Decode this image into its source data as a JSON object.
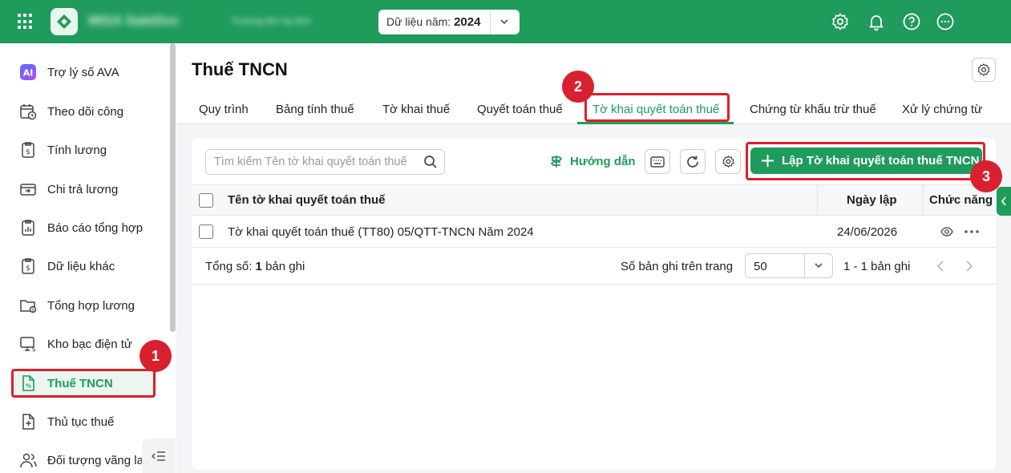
{
  "topbar": {
    "brand": "MISA SaleDoc",
    "company": "Trường Mn hạ tỉnh",
    "year_label": "Dữ liệu năm:",
    "year_value": "2024"
  },
  "sidebar": {
    "items": [
      {
        "label": "Trợ lý số AVA",
        "icon": "ai-icon"
      },
      {
        "label": "Theo dõi công",
        "icon": "calendar-clock-icon"
      },
      {
        "label": "Tính lương",
        "icon": "salary-doc-icon"
      },
      {
        "label": "Chi trả lương",
        "icon": "wallet-icon"
      },
      {
        "label": "Báo cáo tổng hợp",
        "icon": "report-icon"
      },
      {
        "label": "Dữ liệu khác",
        "icon": "data-doc-icon"
      },
      {
        "label": "Tổng hợp lương",
        "icon": "folder-money-icon"
      },
      {
        "label": "Kho bạc điện tử",
        "icon": "monitor-money-icon"
      },
      {
        "label": "Thuế TNCN",
        "icon": "tax-doc-icon"
      },
      {
        "label": "Thủ tục thuế",
        "icon": "doc-plus-icon"
      },
      {
        "label": "Đối tượng vãng lai",
        "icon": "users-icon"
      }
    ]
  },
  "main": {
    "title": "Thuế TNCN",
    "tabs": [
      "Quy trình",
      "Bảng tính thuế",
      "Tờ khai thuế",
      "Quyết toán thuế",
      "Tờ khai quyết toán thuế",
      "Chứng từ khấu trừ thuế",
      "Xử lý chứng từ"
    ],
    "active_tab": "Tờ khai quyết toán thuế"
  },
  "toolbar": {
    "search_placeholder": "Tìm kiếm Tên tờ khai quyết toán thuế",
    "guide_label": "Hướng dẫn",
    "create_label": "Lập Tờ khai quyết toán thuế TNCN"
  },
  "table": {
    "columns": [
      "Tên tờ khai quyết toán thuế",
      "Ngày lập",
      "Chức năng"
    ],
    "rows": [
      {
        "name": "Tờ khai quyết toán thuế (TT80) 05/QTT-TNCN Năm 2024",
        "date": "24/06/2026"
      }
    ]
  },
  "footer": {
    "total_prefix": "Tổng số:",
    "total_count": "1",
    "total_suffix": "bản ghi",
    "per_page_label": "Số bản ghi trên trang",
    "page_size": "50",
    "range": "1 - 1 bản ghi"
  },
  "steps": [
    "1",
    "2",
    "3"
  ],
  "colors": {
    "brand": "#1f9b5c",
    "highlight": "#d9202f"
  }
}
